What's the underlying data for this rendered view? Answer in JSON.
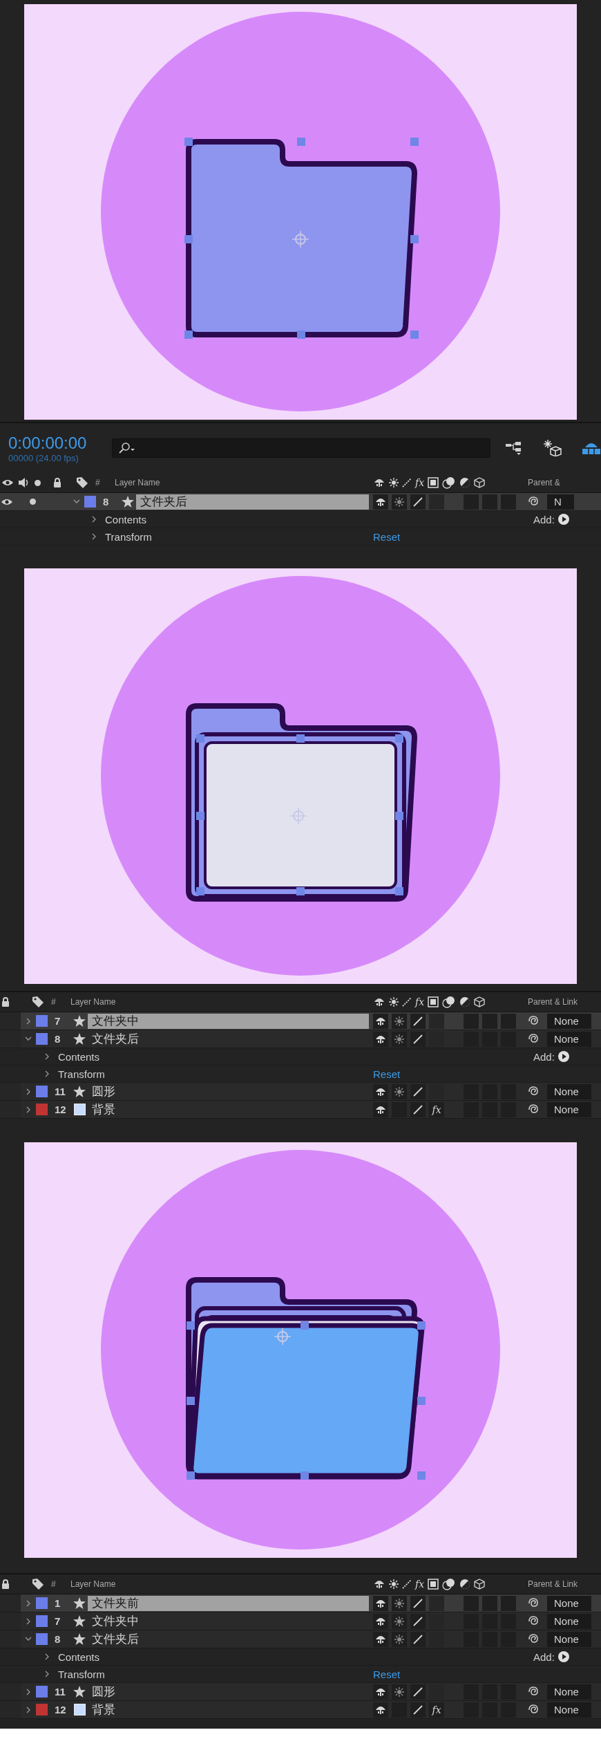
{
  "panels": [
    {
      "composition": {
        "shapes": [
          {
            "kind": "circle",
            "selected": false
          },
          {
            "kind": "folder-back",
            "selected": true
          }
        ]
      },
      "timeline": {
        "time": {
          "timecode": "0:00:00:00",
          "frames": "00000 (24.00 fps)"
        },
        "av_columns": true,
        "header": {
          "number": "#",
          "layer_name": "Layer Name",
          "fx": "fx",
          "parent": "Parent &"
        },
        "layers": [
          {
            "number": "8",
            "name": "文件夹后",
            "color": "#6b7de8",
            "kind": "shape",
            "selected": true,
            "expanded": true,
            "parent": "N",
            "properties": [
              {
                "kind": "add",
                "name": "Contents",
                "action": "Add:"
              },
              {
                "kind": "reset",
                "name": "Transform",
                "action": "Reset"
              }
            ]
          }
        ]
      }
    },
    {
      "composition": {
        "shapes": [
          {
            "kind": "circle",
            "selected": false
          },
          {
            "kind": "folder-back",
            "selected": false
          },
          {
            "kind": "paper",
            "selected": true
          }
        ]
      },
      "timeline": {
        "av_columns": false,
        "header": {
          "number": "#",
          "layer_name": "Layer Name",
          "fx": "fx",
          "parent": "Parent & Link"
        },
        "layers": [
          {
            "number": "7",
            "name": "文件夹中",
            "color": "#6b7de8",
            "kind": "shape",
            "selected": true,
            "expanded": false,
            "parent": "None"
          },
          {
            "number": "8",
            "name": "文件夹后",
            "color": "#6b7de8",
            "kind": "shape",
            "selected": false,
            "expanded": true,
            "parent": "None",
            "properties": [
              {
                "kind": "add",
                "name": "Contents",
                "action": "Add:"
              },
              {
                "kind": "reset",
                "name": "Transform",
                "action": "Reset"
              }
            ]
          },
          {
            "number": "11",
            "name": "圆形",
            "color": "#6b7de8",
            "kind": "shape",
            "selected": false,
            "expanded": false,
            "parent": "None"
          },
          {
            "number": "12",
            "name": "背景",
            "color": "#c03434",
            "kind": "solid",
            "selected": false,
            "expanded": false,
            "parent": "None",
            "effect": "fx"
          }
        ]
      }
    },
    {
      "composition": {
        "shapes": [
          {
            "kind": "circle",
            "selected": false
          },
          {
            "kind": "folder-back",
            "selected": false
          },
          {
            "kind": "paper",
            "selected": false
          },
          {
            "kind": "folder-front",
            "selected": true
          }
        ]
      },
      "timeline": {
        "av_columns": false,
        "header": {
          "number": "#",
          "layer_name": "Layer Name",
          "fx": "fx",
          "parent": "Parent & Link"
        },
        "layers": [
          {
            "number": "1",
            "name": "文件夹前",
            "color": "#6b7de8",
            "kind": "shape",
            "selected": true,
            "expanded": false,
            "parent": "None"
          },
          {
            "number": "7",
            "name": "文件夹中",
            "color": "#6b7de8",
            "kind": "shape",
            "selected": false,
            "expanded": false,
            "parent": "None"
          },
          {
            "number": "8",
            "name": "文件夹后",
            "color": "#6b7de8",
            "kind": "shape",
            "selected": false,
            "expanded": true,
            "parent": "None",
            "properties": [
              {
                "kind": "add",
                "name": "Contents",
                "action": "Add:"
              },
              {
                "kind": "reset",
                "name": "Transform",
                "action": "Reset"
              }
            ]
          },
          {
            "number": "11",
            "name": "圆形",
            "color": "#6b7de8",
            "kind": "shape",
            "selected": false,
            "expanded": false,
            "parent": "None"
          },
          {
            "number": "12",
            "name": "背景",
            "color": "#c03434",
            "kind": "solid",
            "selected": false,
            "expanded": false,
            "parent": "None",
            "effect": "fx"
          }
        ]
      }
    }
  ]
}
